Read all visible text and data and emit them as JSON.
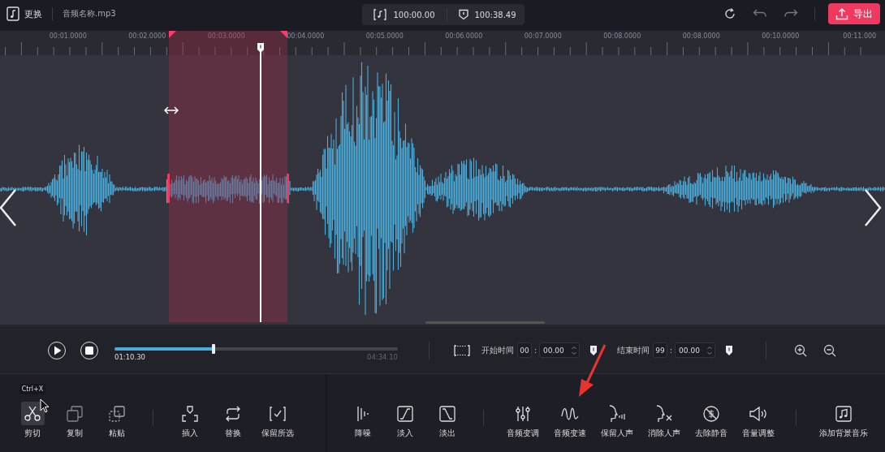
{
  "top_bar": {
    "replace_button": "更换",
    "file_name": "音频名称.mp3",
    "total_duration": "100:00.00",
    "selection_duration": "100:38.49",
    "export_button": "导出"
  },
  "ruler": {
    "labels": [
      "00:01.0000",
      "00:02.0000",
      "00:03.0000",
      "00:04.0000",
      "00:05.0000",
      "00:06.0000",
      "00:07.0000",
      "00:08.0000",
      "00:08.0000",
      "00:10.0000",
      "00:11.000"
    ]
  },
  "transport": {
    "current_time": "01:10.30",
    "total_time": "04:34.10",
    "level": 0.35,
    "start": {
      "label": "开始时间",
      "minutes": "00",
      "separator": ":",
      "seconds": "00.00"
    },
    "end": {
      "label": "结束时间",
      "minutes": "99",
      "separator": ":",
      "seconds": "00.00"
    }
  },
  "tool_groups": [
    [
      {
        "label": "剪切",
        "hovered": true,
        "tooltip": "Ctrl+X"
      },
      {
        "label": "复制",
        "hovered": false
      },
      {
        "label": "粘贴",
        "hovered": false
      }
    ],
    [
      {
        "label": "插入",
        "hovered": false
      },
      {
        "label": "替换",
        "hovered": false
      },
      {
        "label": "保留所选",
        "hovered": false
      }
    ],
    [
      {
        "label": "降噪",
        "hovered": false
      },
      {
        "label": "淡入",
        "hovered": false
      },
      {
        "label": "淡出",
        "hovered": false
      }
    ],
    [
      {
        "label": "音频变调",
        "hovered": false
      },
      {
        "label": "音频变速",
        "hovered": false
      },
      {
        "label": "保留人声",
        "hovered": false
      },
      {
        "label": "消除人声",
        "hovered": false
      },
      {
        "label": "去除静音",
        "hovered": false
      },
      {
        "label": "音量调整",
        "hovered": false
      }
    ],
    [
      {
        "label": "添加背景音乐",
        "hovered": false
      }
    ]
  ]
}
